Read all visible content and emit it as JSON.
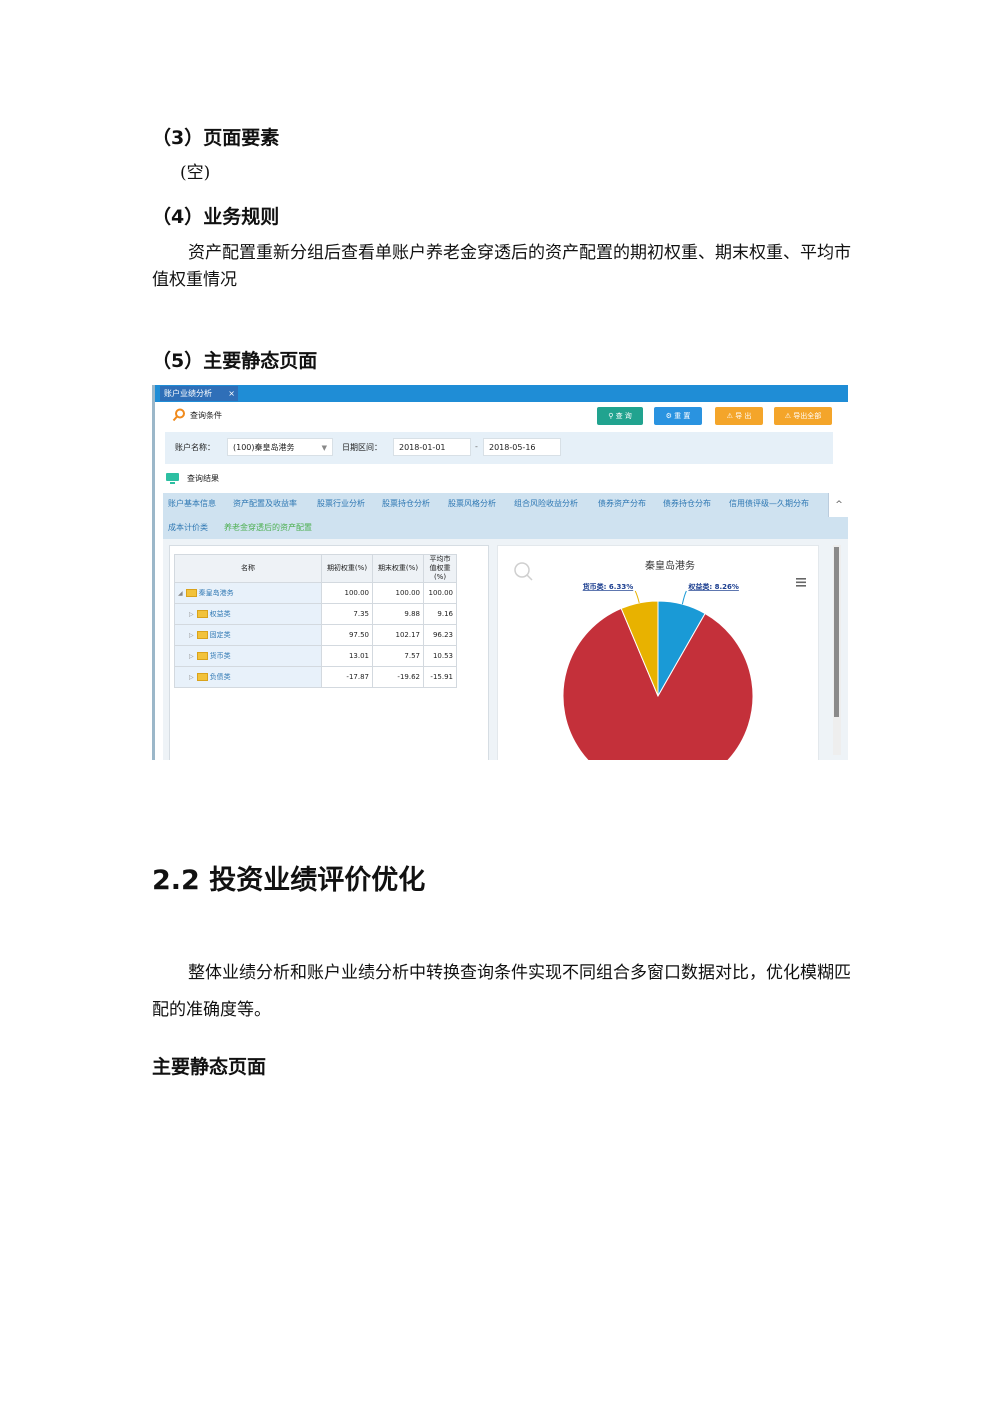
{
  "doc": {
    "s3_heading": "（3）页面要素",
    "s3_body": "(空)",
    "s4_heading": "（4）业务规则",
    "s4_body": "资产配置重新分组后查看单账户养老金穿透后的资产配置的期初权重、期末权重、平均市值权重情况",
    "s5_heading": "（5）主要静态页面",
    "h2": "2.2 投资业绩评价优化",
    "s22_body": "整体业绩分析和账户业绩分析中转换查询条件实现不同组合多窗口数据对比，优化模糊匹配的准确度等。",
    "s22_subheading": "主要静态页面"
  },
  "ui": {
    "tab": {
      "label": "账户业绩分析",
      "close": "×"
    },
    "query": {
      "label": "查询条件",
      "buttons": {
        "search": "查 询",
        "reset": "重 置",
        "export": "导 出",
        "export_all": "导出全部"
      },
      "account_label": "账户名称：",
      "account_value": "(100)秦皇岛港务",
      "date_label": "日期区间：",
      "date_from": "2018-01-01",
      "date_sep": "-",
      "date_to": "2018-05-16"
    },
    "results_label": "查询结果",
    "nav": [
      "账户基本信息",
      "资产配置及收益率",
      "股票行业分析",
      "股票持仓分析",
      "股票风格分析",
      "组合风险收益分析",
      "债券资产分布",
      "债券持仓分布",
      "信用债评级—久期分布",
      "成本计价类",
      "养老金穿透后的资产配置"
    ],
    "collapse_glyph": "^",
    "table": {
      "headers": [
        "名称",
        "期初权重(%)",
        "期末权重(%)",
        "平均市值权重(%)"
      ],
      "rows": [
        {
          "name": "秦皇岛港务",
          "v1": "100.00",
          "v2": "100.00",
          "v3": "100.00"
        },
        {
          "name": "权益类",
          "v1": "7.35",
          "v2": "9.88",
          "v3": "9.16"
        },
        {
          "name": "固定类",
          "v1": "97.50",
          "v2": "102.17",
          "v3": "96.23"
        },
        {
          "name": "货币类",
          "v1": "13.01",
          "v2": "7.57",
          "v3": "10.53"
        },
        {
          "name": "负债类",
          "v1": "-17.87",
          "v2": "-19.62",
          "v3": "-15.91"
        }
      ]
    },
    "colors": {
      "equity": "#1a9ad6",
      "currency": "#e8b200",
      "fixed": "#c4303a",
      "tabbar": "#1f8dd6",
      "search_btn": "#21a38f",
      "reset_btn": "#2a93e0",
      "export_btn": "#f4a52a"
    }
  },
  "chart_data": {
    "type": "pie",
    "title": "秦皇岛港务",
    "slices": [
      {
        "label": "权益类",
        "value": 8.26,
        "display": "权益类: 8.26%"
      },
      {
        "label": "固定类",
        "value": 85.41
      },
      {
        "label": "货币类",
        "value": 6.33,
        "display": "货币类: 6.33%"
      }
    ]
  }
}
